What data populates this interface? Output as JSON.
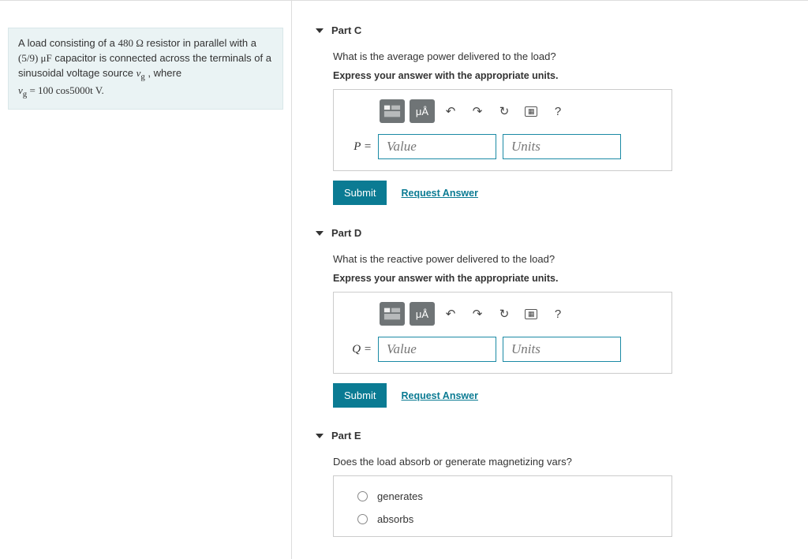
{
  "problem": {
    "line1_pre": "A load consisting of a ",
    "line1_r": "480 Ω",
    "line1_mid": " resistor in parallel with a ",
    "line2_c": "(5/9) μF",
    "line2_rest": " capacitor is connected across the terminals of a sinusoidal voltage source ",
    "line2_vg": "v",
    "line2_sub": "g",
    "line2_comma": " , where ",
    "line3_eq": "v",
    "line3_sub": "g",
    "line3_rest": " = 100 cos5000t V."
  },
  "parts": [
    {
      "id": "C",
      "title": "Part C",
      "question": "What is the average power delivered to the load?",
      "instruction": "Express your answer with the appropriate units.",
      "symbol": "P =",
      "value_placeholder": "Value",
      "units_placeholder": "Units"
    },
    {
      "id": "D",
      "title": "Part D",
      "question": "What is the reactive power delivered to the load?",
      "instruction": "Express your answer with the appropriate units.",
      "symbol": "Q =",
      "value_placeholder": "Value",
      "units_placeholder": "Units"
    },
    {
      "id": "E",
      "title": "Part E",
      "question": "Does the load absorb or generate magnetizing vars?",
      "options": [
        "generates",
        "absorbs"
      ]
    }
  ],
  "toolbar": {
    "templates": "templates",
    "units_btn": "μÅ",
    "undo": "↶",
    "redo": "↷",
    "reset": "↻",
    "keyboard": "⌨",
    "help": "?"
  },
  "buttons": {
    "submit": "Submit",
    "request": "Request Answer"
  }
}
